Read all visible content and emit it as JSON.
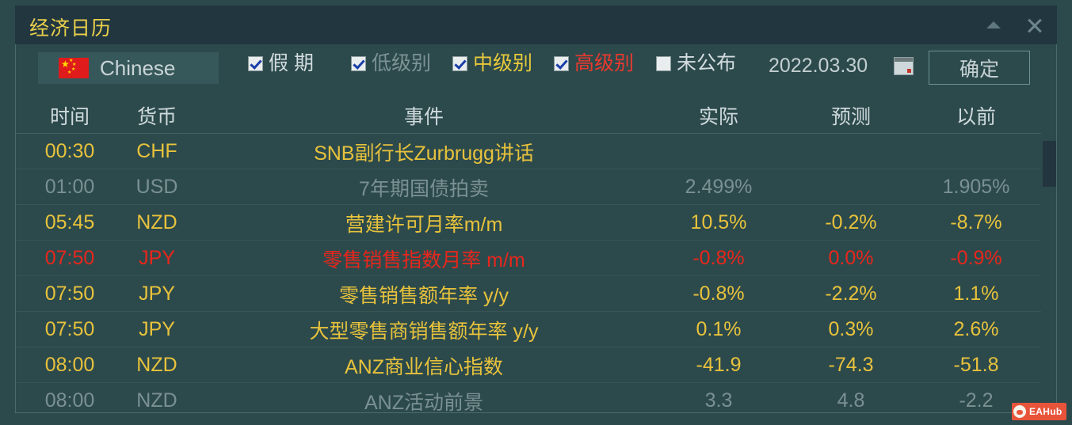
{
  "window": {
    "title": "经济日历",
    "collapse_icon": "triangle-up-icon",
    "close_icon": "close-icon"
  },
  "toolbar": {
    "language": {
      "flag_icon": "china-flag-icon",
      "label": "Chinese"
    },
    "filters": [
      {
        "label": "假 期",
        "checked": true,
        "color": "#d3dcde"
      },
      {
        "label": "低级别",
        "checked": true,
        "color": "#7d9295"
      },
      {
        "label": "中级别",
        "checked": true,
        "color": "#e8c93c"
      },
      {
        "label": "高级别",
        "checked": true,
        "color": "#e8392e"
      },
      {
        "label": "未公布",
        "checked": false,
        "color": "#d3dcde"
      }
    ],
    "date_value": "2022.03.30",
    "calendar_icon": "calendar-icon",
    "confirm_label": "确定"
  },
  "table": {
    "headers": {
      "time": "时间",
      "currency": "货币",
      "event": "事件",
      "actual": "实际",
      "forecast": "预测",
      "previous": "以前"
    },
    "rows": [
      {
        "time": "00:30",
        "currency": "CHF",
        "event": "SNB副行长Zurbrugg讲话",
        "actual": "",
        "forecast": "",
        "previous": "",
        "style": "yellow"
      },
      {
        "time": "01:00",
        "currency": "USD",
        "event": "7年期国债拍卖",
        "actual": "2.499%",
        "forecast": "",
        "previous": "1.905%",
        "style": "gray"
      },
      {
        "time": "05:45",
        "currency": "NZD",
        "event": "营建许可月率m/m",
        "actual": "10.5%",
        "forecast": "-0.2%",
        "previous": "-8.7%",
        "style": "yellow"
      },
      {
        "time": "07:50",
        "currency": "JPY",
        "event": "零售销售指数月率 m/m",
        "actual": "-0.8%",
        "forecast": "0.0%",
        "previous": "-0.9%",
        "style": "red"
      },
      {
        "time": "07:50",
        "currency": "JPY",
        "event": "零售销售额年率 y/y",
        "actual": "-0.8%",
        "forecast": "-2.2%",
        "previous": "1.1%",
        "style": "yellow"
      },
      {
        "time": "07:50",
        "currency": "JPY",
        "event": "大型零售商销售额年率 y/y",
        "actual": "0.1%",
        "forecast": "0.3%",
        "previous": "2.6%",
        "style": "yellow"
      },
      {
        "time": "08:00",
        "currency": "NZD",
        "event": "ANZ商业信心指数",
        "actual": "-41.9",
        "forecast": "-74.3",
        "previous": "-51.8",
        "style": "yellow"
      },
      {
        "time": "08:00",
        "currency": "NZD",
        "event": "ANZ活动前景",
        "actual": "3.3",
        "forecast": "4.8",
        "previous": "-2.2",
        "style": "gray"
      }
    ]
  },
  "watermark": {
    "text": "EAHub",
    "icon": "pig-logo-icon"
  },
  "colors": {
    "window_bg": "#2c4a4c",
    "titlebar_bg": "#223640",
    "title_text": "#ead14a",
    "row_yellow": "#e8c23c",
    "row_gray": "#7b9093",
    "row_red": "#e8261c",
    "header_text": "#cfd9db",
    "watermark_bg": "#e8543a"
  }
}
